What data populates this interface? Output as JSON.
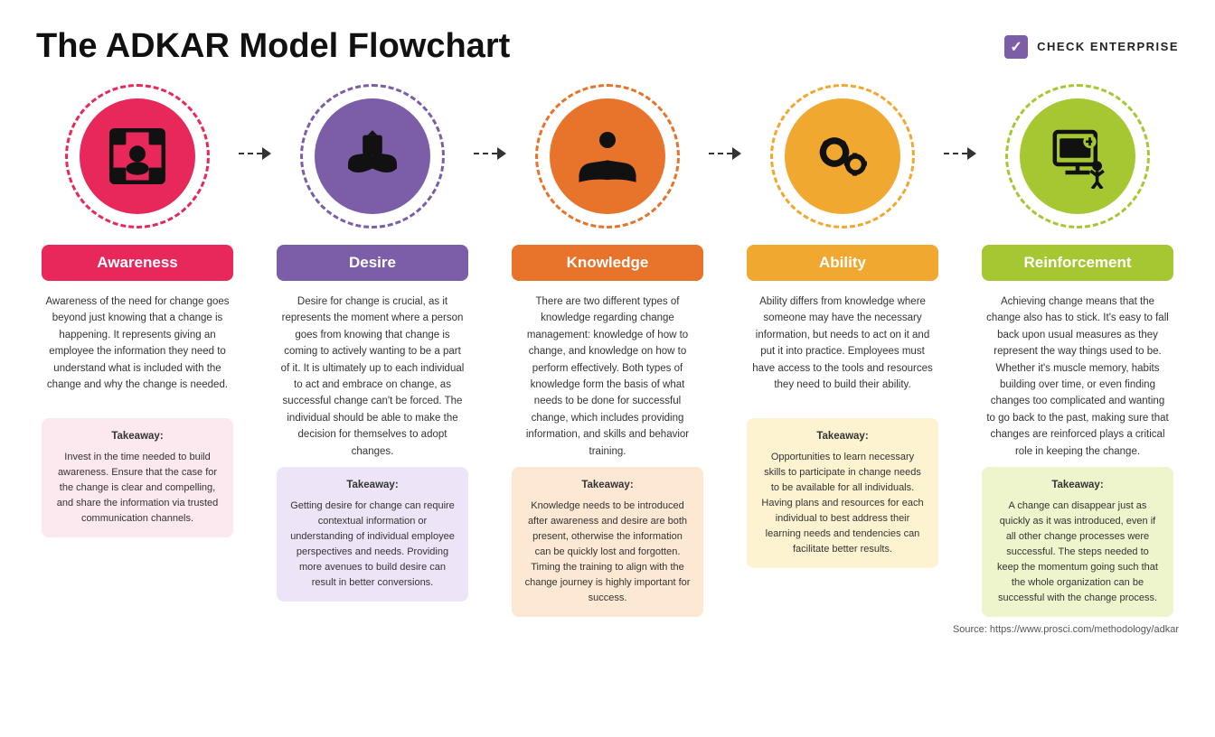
{
  "header": {
    "title": "The ADKAR Model Flowchart",
    "brand_label": "CHECK ENTERPRISE"
  },
  "steps": [
    {
      "id": "awareness",
      "label": "Awareness",
      "description": "Awareness of the need for change goes beyond just knowing that a change is happening. It represents giving an employee the information they need to understand what is included with the change and why the change is needed.",
      "takeaway_title": "Takeaway:",
      "takeaway": "Invest in the time needed to build awareness. Ensure that the case for the change is clear and compelling, and share the information via trusted communication channels."
    },
    {
      "id": "desire",
      "label": "Desire",
      "description": "Desire for change is crucial, as it represents the moment where a person goes from knowing that change is coming to actively wanting to be a part of it. It is ultimately up to each individual to act and embrace on change, as successful change can't be forced. The individual should be able to make the decision for themselves to adopt changes.",
      "takeaway_title": "Takeaway:",
      "takeaway": "Getting desire for change can require contextual information or understanding of individual employee perspectives and needs. Providing more avenues to build desire can result in better conversions."
    },
    {
      "id": "knowledge",
      "label": "Knowledge",
      "description": "There are two different types of knowledge regarding change management: knowledge of how to change, and knowledge on how to perform effectively. Both types of knowledge form the basis of what needs to be done for successful change, which includes providing information, and skills and behavior training.",
      "takeaway_title": "Takeaway:",
      "takeaway": "Knowledge needs to be introduced after awareness and desire are both present, otherwise the information can be quickly lost and forgotten. Timing the training to align with the change journey is highly important for success."
    },
    {
      "id": "ability",
      "label": "Ability",
      "description": "Ability differs from knowledge where someone may have the necessary information, but needs to act on it and put it into practice. Employees must have access to the tools and resources they need to build their ability.",
      "takeaway_title": "Takeaway:",
      "takeaway": "Opportunities to learn necessary skills to participate in change needs to be available for all individuals. Having plans and resources for each individual to best address their learning needs and tendencies can facilitate better results."
    },
    {
      "id": "reinforcement",
      "label": "Reinforcement",
      "description": "Achieving change means that the change also has to stick. It's easy to fall back upon usual measures as they represent the way things used to be. Whether it's muscle memory, habits building over time, or even finding changes too complicated and wanting to go back to the past, making sure that changes are reinforced plays a critical role in keeping the change.",
      "takeaway_title": "Takeaway:",
      "takeaway": "A change can disappear just as quickly as it was introduced, even if all other change processes were successful. The steps needed to keep the momentum going such that the whole organization can be successful with the change process."
    }
  ],
  "source": "Source: https://www.prosci.com/methodology/adkar"
}
